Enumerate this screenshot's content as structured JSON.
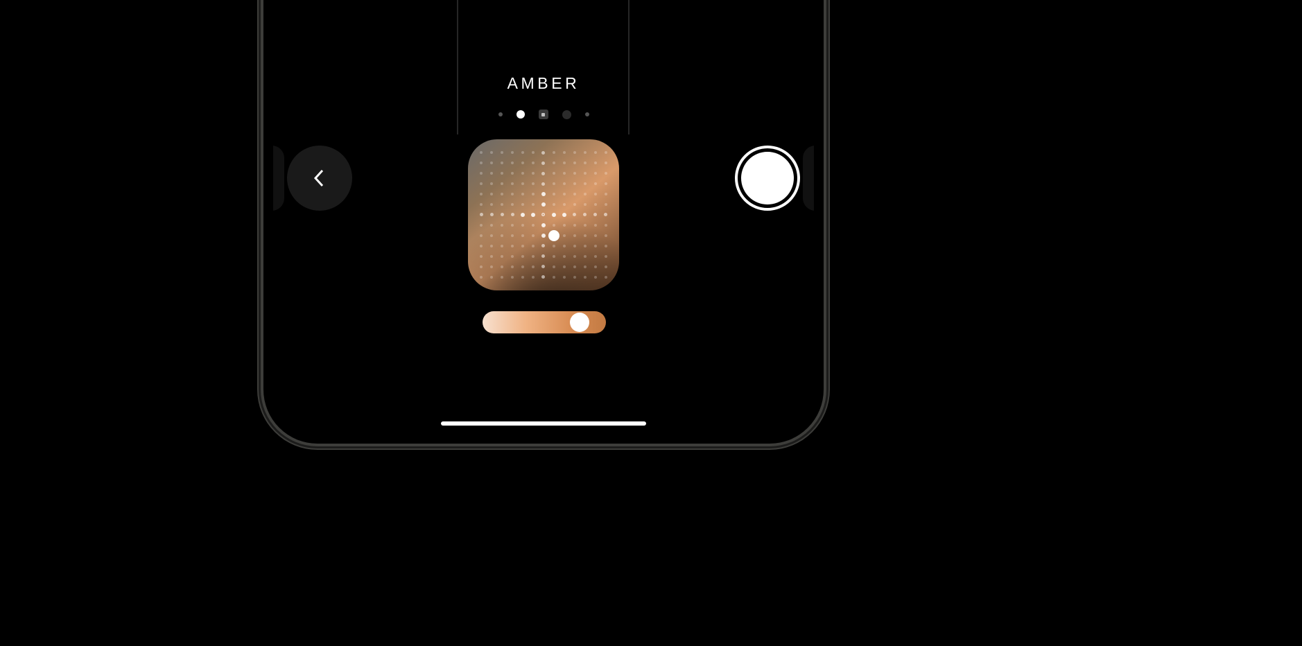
{
  "header": {
    "preset_label": "AMBER"
  },
  "indicators": {
    "count": 5,
    "active_index": 1
  },
  "color_pad": {
    "grid": 13,
    "center": {
      "col": 6,
      "row": 6
    },
    "picker": {
      "col": 7,
      "row": 8
    }
  },
  "slider": {
    "value_pct": 85
  },
  "icons": {
    "back": "chevron-left-icon",
    "shutter": "shutter-icon"
  }
}
